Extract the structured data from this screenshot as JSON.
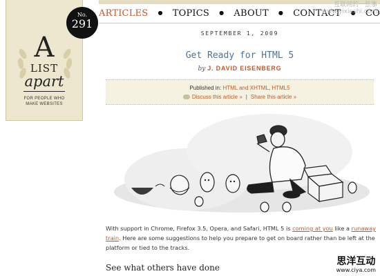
{
  "logo": {
    "big_letter": "A",
    "line2": "LIST",
    "line3": "apart",
    "tagline_1": "FOR PEOPLE WHO",
    "tagline_2": "MAKE WEBSITES"
  },
  "issue": {
    "label": "No.",
    "number": "291"
  },
  "nav": {
    "items": [
      "ARTICLES",
      "TOPICS",
      "ABOUT",
      "CONTACT",
      "CONTRIBUT"
    ],
    "active": "ARTICLES"
  },
  "watermark_top": {
    "line1": "互联网的一些事",
    "line2": "www.yixieshi.com"
  },
  "article": {
    "date": "SEPTEMBER 1, 2009",
    "title": "Get Ready for HTML 5",
    "by": "by",
    "author": "J. DAVID EISENBERG",
    "published_label": "Published in:",
    "tags": [
      "HTML and XHTML",
      "HTML5"
    ],
    "tag_sep": ",",
    "discuss": "Discuss this article »",
    "share": "Share this article »",
    "share_sep": "|",
    "para_1": "With support in Chrome, Firefox 3.5, Opera, and Safari, HTML 5 is ",
    "link_1": "coming at you",
    "para_2": " like a ",
    "link_2": "runaway train",
    "para_3": ". Here are some suggestions to help you prepare to get on board rather than be left at the platform or tied to the tracks.",
    "subhead": "See what others have done"
  },
  "watermark_bottom": {
    "cn": "思洋互动",
    "url": "www.ciya.com"
  },
  "colors": {
    "accent": "#c0592b",
    "title_blue": "#4d7299",
    "logo_bg": "#ede7cf"
  }
}
